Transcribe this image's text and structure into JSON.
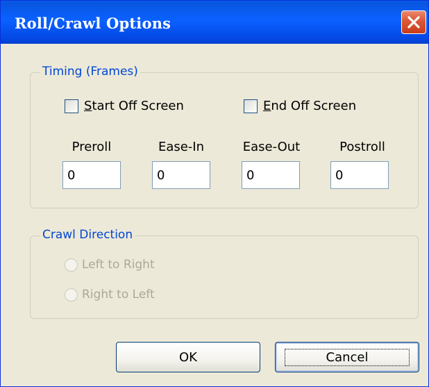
{
  "window": {
    "title": "Roll/Crawl Options",
    "close_icon": "close-x-icon"
  },
  "timing": {
    "legend": "Timing (Frames)",
    "start_off_screen": {
      "accel": "S",
      "rest": "tart Off Screen",
      "checked": false
    },
    "end_off_screen": {
      "accel": "E",
      "rest": "nd Off Screen",
      "checked": false
    },
    "fields": {
      "preroll": {
        "label": "Preroll",
        "value": "0"
      },
      "ease_in": {
        "label": "Ease-In",
        "value": "0"
      },
      "ease_out": {
        "label": "Ease-Out",
        "value": "0"
      },
      "postroll": {
        "label": "Postroll",
        "value": "0"
      }
    }
  },
  "crawl": {
    "legend": "Crawl Direction",
    "left_to_right": "Left to Right",
    "right_to_left": "Right to Left",
    "enabled": false
  },
  "buttons": {
    "ok": "OK",
    "cancel": "Cancel"
  },
  "colors": {
    "title_bar": "#0a5ae8",
    "group_legend": "#0046d5",
    "disabled_text": "#aca899",
    "close_button": "#dd5a3a"
  }
}
